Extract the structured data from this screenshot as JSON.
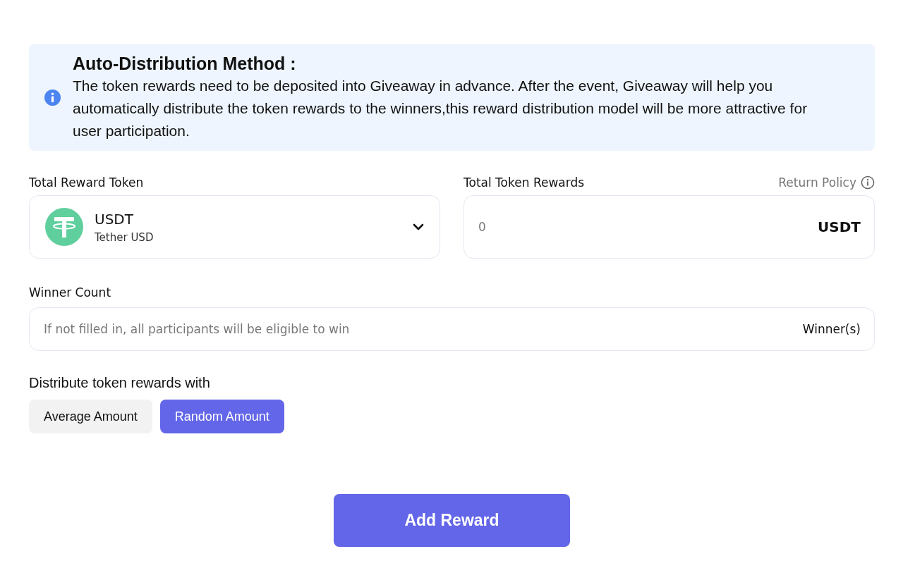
{
  "notice": {
    "title": "Auto-Distribution Method :",
    "text": "The token rewards need to be deposited into Giveaway in advance. After the event, Giveaway will help you automatically distribute the token rewards to the winners,this reward distribution model will be more attractive for user participation."
  },
  "token": {
    "label": "Total Reward Token",
    "symbol": "USDT",
    "name": "Tether USD"
  },
  "amount": {
    "label": "Total Token Rewards",
    "link": "Return Policy",
    "placeholder": "0",
    "unit": "USDT"
  },
  "winners": {
    "label": "Winner Count",
    "placeholder": "If not filled in, all participants will be eligible to win",
    "unit": "Winner(s)"
  },
  "distribution": {
    "label": "Distribute token rewards with",
    "options": [
      {
        "label": "Average Amount",
        "selected": false
      },
      {
        "label": "Random Amount",
        "selected": true
      }
    ]
  },
  "submit": "Add Reward"
}
